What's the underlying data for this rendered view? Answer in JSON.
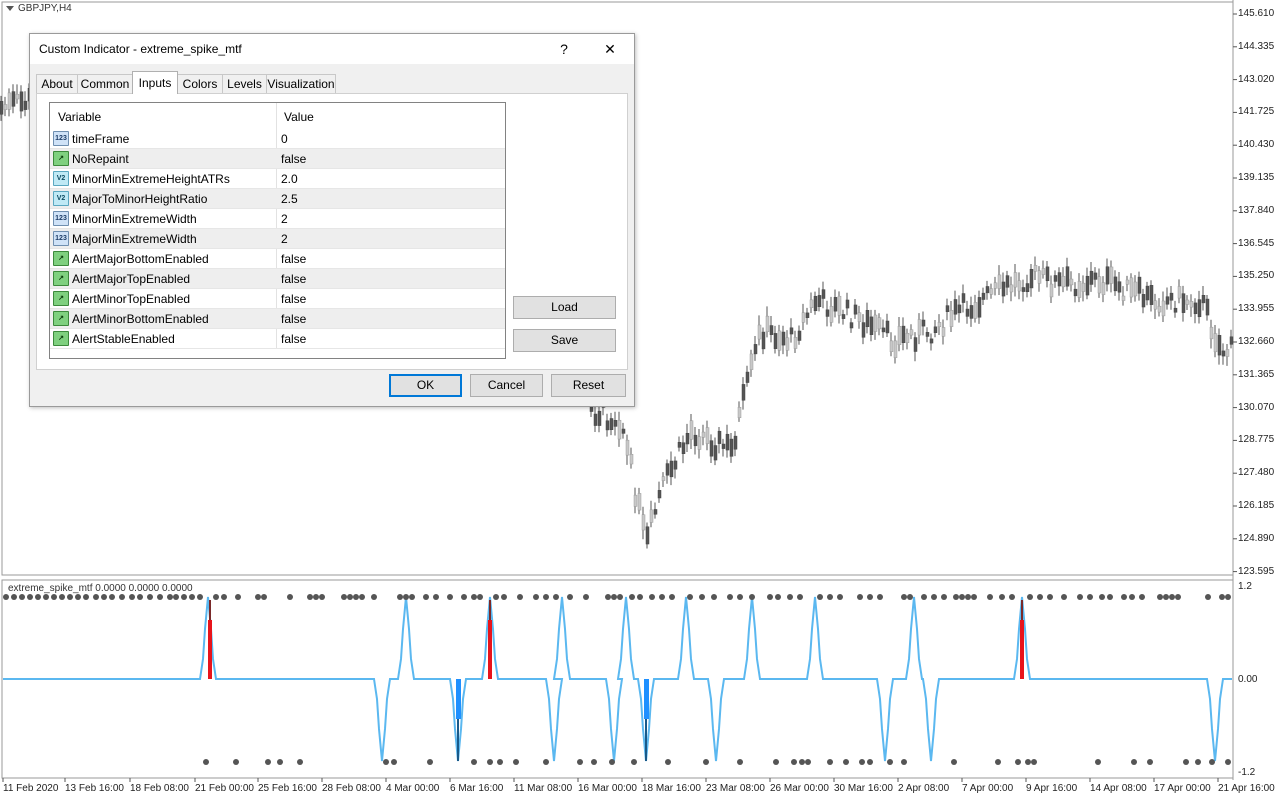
{
  "chart": {
    "symbol": "GBPJPY,H4",
    "indicator_label": "extreme_spike_mtf 0.0000 0.0000 0.0000",
    "price_axis": [
      "145.610",
      "144.335",
      "143.020",
      "141.725",
      "140.430",
      "139.135",
      "137.840",
      "136.545",
      "135.250",
      "133.955",
      "132.660",
      "131.365",
      "130.070",
      "128.775",
      "127.480",
      "126.185",
      "124.890",
      "123.595"
    ],
    "indicator_axis": [
      "1.2",
      "0.00",
      "-1.2"
    ],
    "time_axis": [
      "11 Feb 2020",
      "13 Feb 16:00",
      "18 Feb 08:00",
      "21 Feb 00:00",
      "25 Feb 16:00",
      "28 Feb 08:00",
      "4 Mar 00:00",
      "6 Mar 16:00",
      "11 Mar 08:00",
      "16 Mar 00:00",
      "18 Mar 16:00",
      "23 Mar 08:00",
      "26 Mar 00:00",
      "30 Mar 16:00",
      "2 Apr 08:00",
      "7 Apr 00:00",
      "9 Apr 16:00",
      "14 Apr 08:00",
      "17 Apr 00:00",
      "21 Apr 16:00"
    ],
    "colors": {
      "bull": "#c8c8c8",
      "bear": "#555555",
      "line": "#5bb8f0",
      "spike_up": "#e8141b",
      "spike_down": "#1e90ff",
      "dots": "#555555"
    }
  },
  "dialog": {
    "title": "Custom Indicator - extreme_spike_mtf",
    "help_glyph": "?",
    "close_glyph": "✕",
    "tabs": [
      "About",
      "Common",
      "Inputs",
      "Colors",
      "Levels",
      "Visualization"
    ],
    "active_tab": "Inputs",
    "columns": {
      "variable": "Variable",
      "value": "Value"
    },
    "inputs": [
      {
        "icon": "123",
        "name": "timeFrame",
        "value": "0"
      },
      {
        "icon": "bool",
        "name": "NoRepaint",
        "value": "false"
      },
      {
        "icon": "v2",
        "name": "MinorMinExtremeHeightATRs",
        "value": "2.0"
      },
      {
        "icon": "v2",
        "name": "MajorToMinorHeightRatio",
        "value": "2.5"
      },
      {
        "icon": "123",
        "name": "MinorMinExtremeWidth",
        "value": "2"
      },
      {
        "icon": "123",
        "name": "MajorMinExtremeWidth",
        "value": "2"
      },
      {
        "icon": "bool",
        "name": "AlertMajorBottomEnabled",
        "value": "false"
      },
      {
        "icon": "bool",
        "name": "AlertMajorTopEnabled",
        "value": "false"
      },
      {
        "icon": "bool",
        "name": "AlertMinorTopEnabled",
        "value": "false"
      },
      {
        "icon": "bool",
        "name": "AlertMinorBottomEnabled",
        "value": "false"
      },
      {
        "icon": "bool",
        "name": "AlertStableEnabled",
        "value": "false"
      }
    ],
    "buttons": {
      "load": "Load",
      "save": "Save",
      "ok": "OK",
      "cancel": "Cancel",
      "reset": "Reset"
    }
  }
}
